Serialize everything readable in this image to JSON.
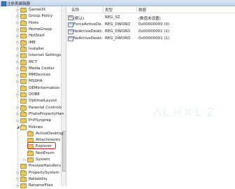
{
  "window": {
    "title": "注册表编辑器"
  },
  "tree": {
    "items": [
      {
        "label": "GameUX",
        "expander": "▷"
      },
      {
        "label": "Group Policy",
        "expander": "▷"
      },
      {
        "label": "Hints",
        "expander": "▷"
      },
      {
        "label": "HomeGroup",
        "expander": "▷"
      },
      {
        "label": "HotStart",
        "expander": "▷"
      },
      {
        "label": "IME",
        "expander": "▷"
      },
      {
        "label": "Installer",
        "expander": "▷"
      },
      {
        "label": "Internet Settings",
        "expander": "▷"
      },
      {
        "label": "MCT",
        "expander": "▷"
      },
      {
        "label": "Media Center",
        "expander": "▷"
      },
      {
        "label": "MMDevices",
        "expander": "▷"
      },
      {
        "label": "MSSHA",
        "expander": "▷"
      },
      {
        "label": "OEMInformation",
        "expander": ""
      },
      {
        "label": "OOBE",
        "expander": "▷"
      },
      {
        "label": "OptimalLayout",
        "expander": ""
      },
      {
        "label": "Parental Controls",
        "expander": "▷"
      },
      {
        "label": "PhotoPropertyHan",
        "expander": "▷"
      },
      {
        "label": "PnPSysprep",
        "expander": "▷"
      },
      {
        "label": "Policies",
        "expander": "◢"
      },
      {
        "label": "ActiveDesktop",
        "expander": ""
      },
      {
        "label": "Attachments",
        "expander": ""
      },
      {
        "label": "Explorer",
        "expander": ""
      },
      {
        "label": "NonEnum",
        "expander": ""
      },
      {
        "label": "System",
        "expander": "▷"
      },
      {
        "label": "PreviewHandlers",
        "expander": ""
      },
      {
        "label": "PropertySystem",
        "expander": "▷"
      },
      {
        "label": "Reliability",
        "expander": "▷"
      },
      {
        "label": "RenameFiles",
        "expander": "▷"
      }
    ]
  },
  "values": {
    "headers": {
      "name": "名称",
      "type": "类型",
      "data": "数据"
    },
    "rows": [
      {
        "name": "(默认)",
        "type": "REG_SZ",
        "data": "(数值未设置)",
        "icon": "string-value-icon"
      },
      {
        "name": "ForceActiveDe...",
        "type": "REG_DWORD",
        "data": "0x00000000 (0)",
        "icon": "dword-value-icon"
      },
      {
        "name": "NoActiveDeskt...",
        "type": "REG_DWORD",
        "data": "0x00000001 (1)",
        "icon": "dword-value-icon"
      },
      {
        "name": "NoActiveDeskt...",
        "type": "REG_DWORD",
        "data": "0x00000001 (1)",
        "icon": "dword-value-icon"
      }
    ]
  },
  "colors": {
    "highlight_box": "#d21a1a",
    "folder": "#ecc960"
  }
}
